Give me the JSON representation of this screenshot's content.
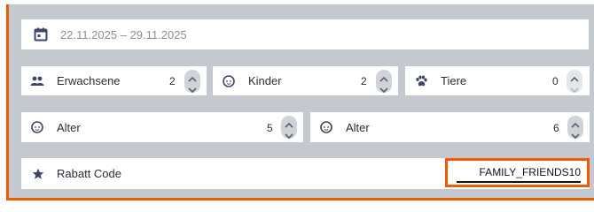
{
  "date_range": {
    "value": "22.11.2025 – 29.11.2025",
    "icon": "calendar-icon"
  },
  "guests": [
    {
      "label": "Erwachsene",
      "value": "2",
      "icon": "people-icon",
      "stepper_up_enabled": true,
      "stepper_down_enabled": true
    },
    {
      "label": "Kinder",
      "value": "2",
      "icon": "baby-icon",
      "stepper_up_enabled": true,
      "stepper_down_enabled": true
    },
    {
      "label": "Tiere",
      "value": "0",
      "icon": "paw-icon",
      "stepper_up_enabled": true,
      "stepper_down_enabled": false
    }
  ],
  "children_ages": [
    {
      "label": "Alter",
      "value": "5",
      "icon": "baby-icon"
    },
    {
      "label": "Alter",
      "value": "6",
      "icon": "baby-icon"
    }
  ],
  "promo": {
    "label": "Rabatt Code",
    "value": "FAMILY_FRIENDS10",
    "icon": "star-icon",
    "highlight_color": "#f05a00"
  },
  "colors": {
    "panel_bg": "#c3c9ce",
    "accent": "#f05a00",
    "icon": "#3e4566"
  }
}
